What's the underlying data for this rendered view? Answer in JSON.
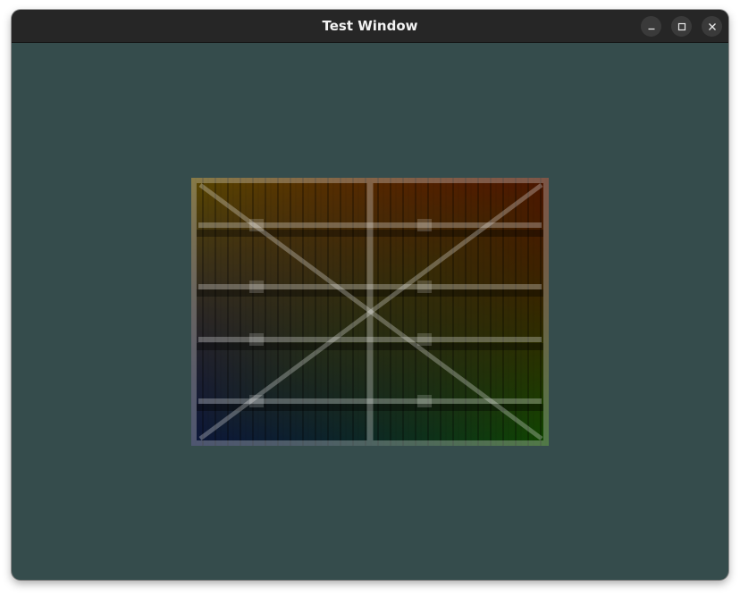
{
  "window": {
    "title": "Test Window",
    "background_color": "#354c4c"
  },
  "titlebar_buttons": {
    "minimize_icon": "minimize-icon",
    "maximize_icon": "maximize-icon",
    "close_icon": "close-icon"
  },
  "texture": {
    "description_icon": "wooden-crate-texture",
    "corner_colors": {
      "top_left": "#c8a000",
      "top_right": "#e00000",
      "bottom_left": "#0000c8",
      "bottom_right": "#22a000"
    }
  }
}
